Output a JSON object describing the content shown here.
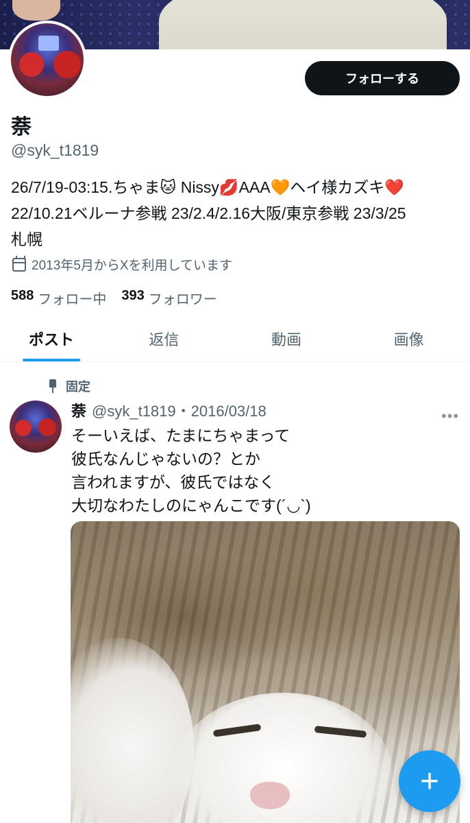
{
  "profile": {
    "follow_label": "フォローする",
    "display_name": "萘",
    "handle": "@syk_t1819",
    "bio": "26/7/19-03:15.ちゃま🐱 Nissy💋AAA🧡ヘイ様カズキ❤️\n22/10.21ベルーナ参戦 23/2.4/2.16大阪/東京参戦 23/3/25\n札幌",
    "joined": "2013年5月からXを利用しています",
    "following_count": "588",
    "following_label": "フォロー中",
    "followers_count": "393",
    "followers_label": "フォロワー"
  },
  "tabs": [
    {
      "label": "ポスト"
    },
    {
      "label": "返信"
    },
    {
      "label": "動画"
    },
    {
      "label": "画像"
    }
  ],
  "pinned_tweet": {
    "pinned_label": "固定",
    "name": "萘",
    "meta": "@syk_t1819・2016/03/18",
    "more": "•••",
    "text": "そーいえば、たまにちゃまって\n彼氏なんじゃないの？とか\n言われますが、彼氏ではなく\n大切なわたしのにゃんこです(´◡`)"
  },
  "fab": {
    "icon": "+"
  },
  "colors": {
    "accent": "#1d9bf0",
    "text": "#0f1419",
    "muted": "#536471"
  }
}
